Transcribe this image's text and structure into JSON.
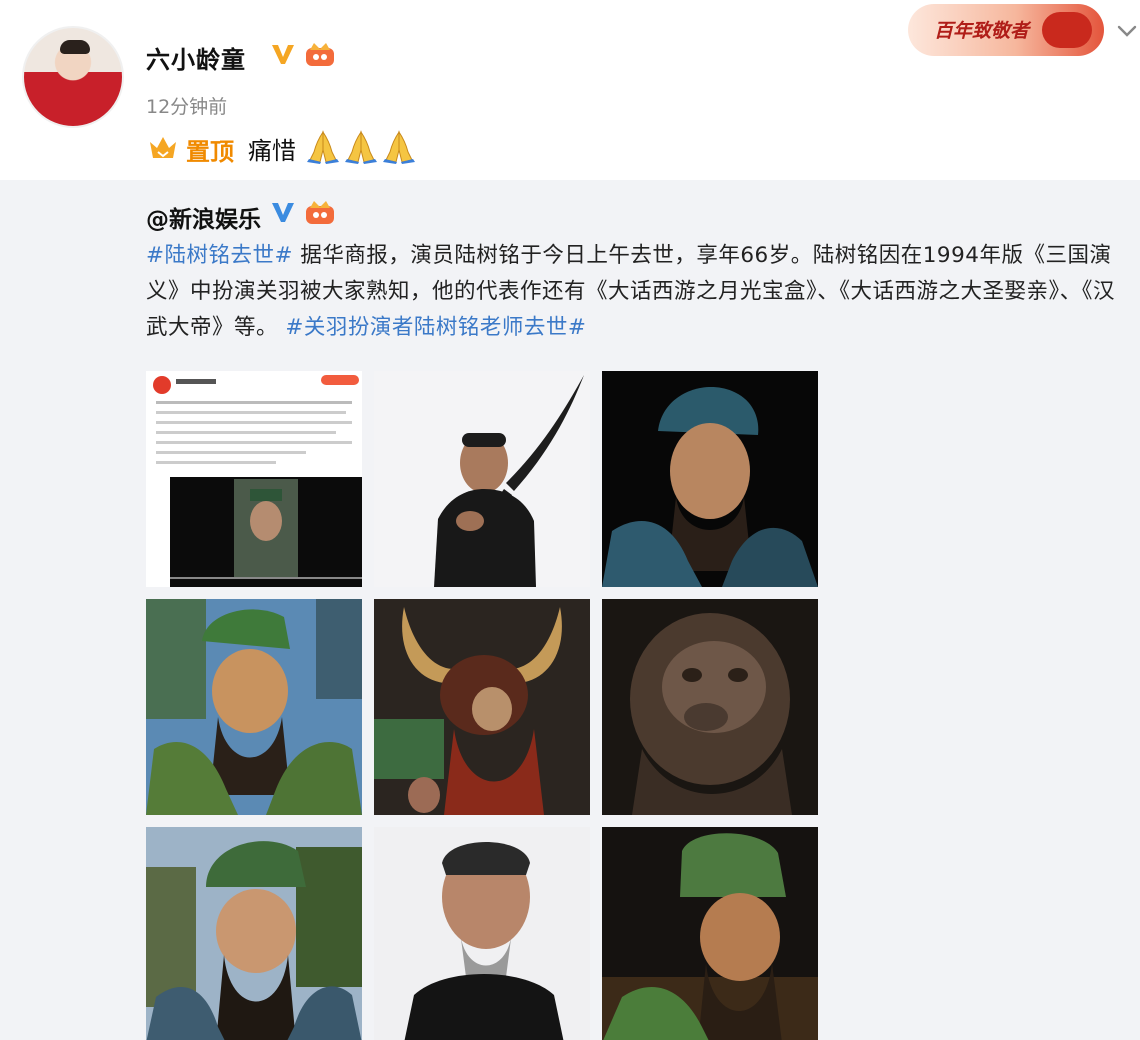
{
  "post": {
    "username": "六小龄童",
    "time": "12分钟前",
    "pin_label": "置顶",
    "text": "痛惜",
    "emoji": [
      "pray-icon",
      "pray-icon",
      "pray-icon"
    ]
  },
  "campaign_badge": {
    "text": "百年致敬者"
  },
  "repost": {
    "author": "@新浪娱乐",
    "hashtag_1": "#陆树铭去世#",
    "body": "据华商报，演员陆树铭于今日上午去世，享年66岁。陆树铭因在1994年版《三国演义》中扮演关羽被大家熟知，他的代表作还有《大话西游之月光宝盒》、《大话西游之大圣娶亲》、《汉武大帝》等。",
    "hashtag_2": "#关羽扮演者陆树铭老师去世#"
  },
  "images": [
    "screenshot-thumbnail",
    "actor-with-blade-photo",
    "guan-yu-blue-costume-photo",
    "guan-yu-green-costume-photo",
    "bull-demon-costume-photo",
    "bull-demon-closeup-photo",
    "guan-yu-green-hat-photo",
    "actor-portrait-photo",
    "guan-yu-dark-background-photo"
  ],
  "colors": {
    "link": "#3b79c8",
    "pin": "#f08a00",
    "verified": "#f5a623",
    "repost_bg": "#f2f3f6"
  }
}
